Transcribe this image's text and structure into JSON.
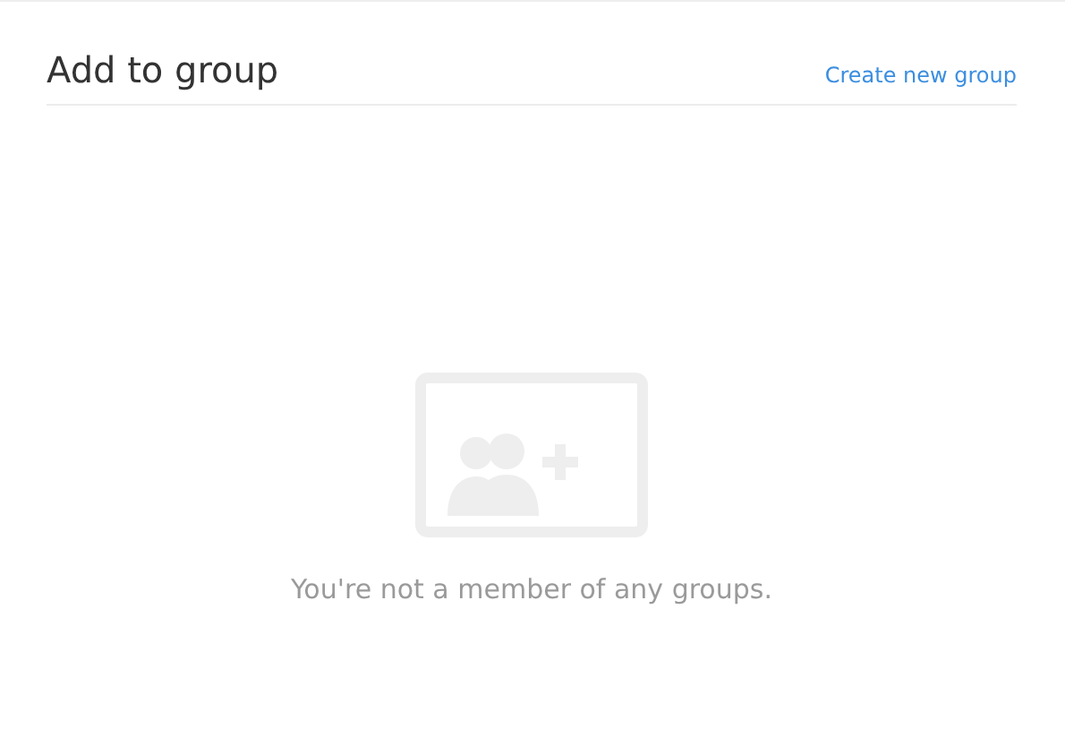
{
  "header": {
    "title": "Add to group",
    "action": "Create new group"
  },
  "empty_state": {
    "message": "You're not a member of any groups."
  }
}
